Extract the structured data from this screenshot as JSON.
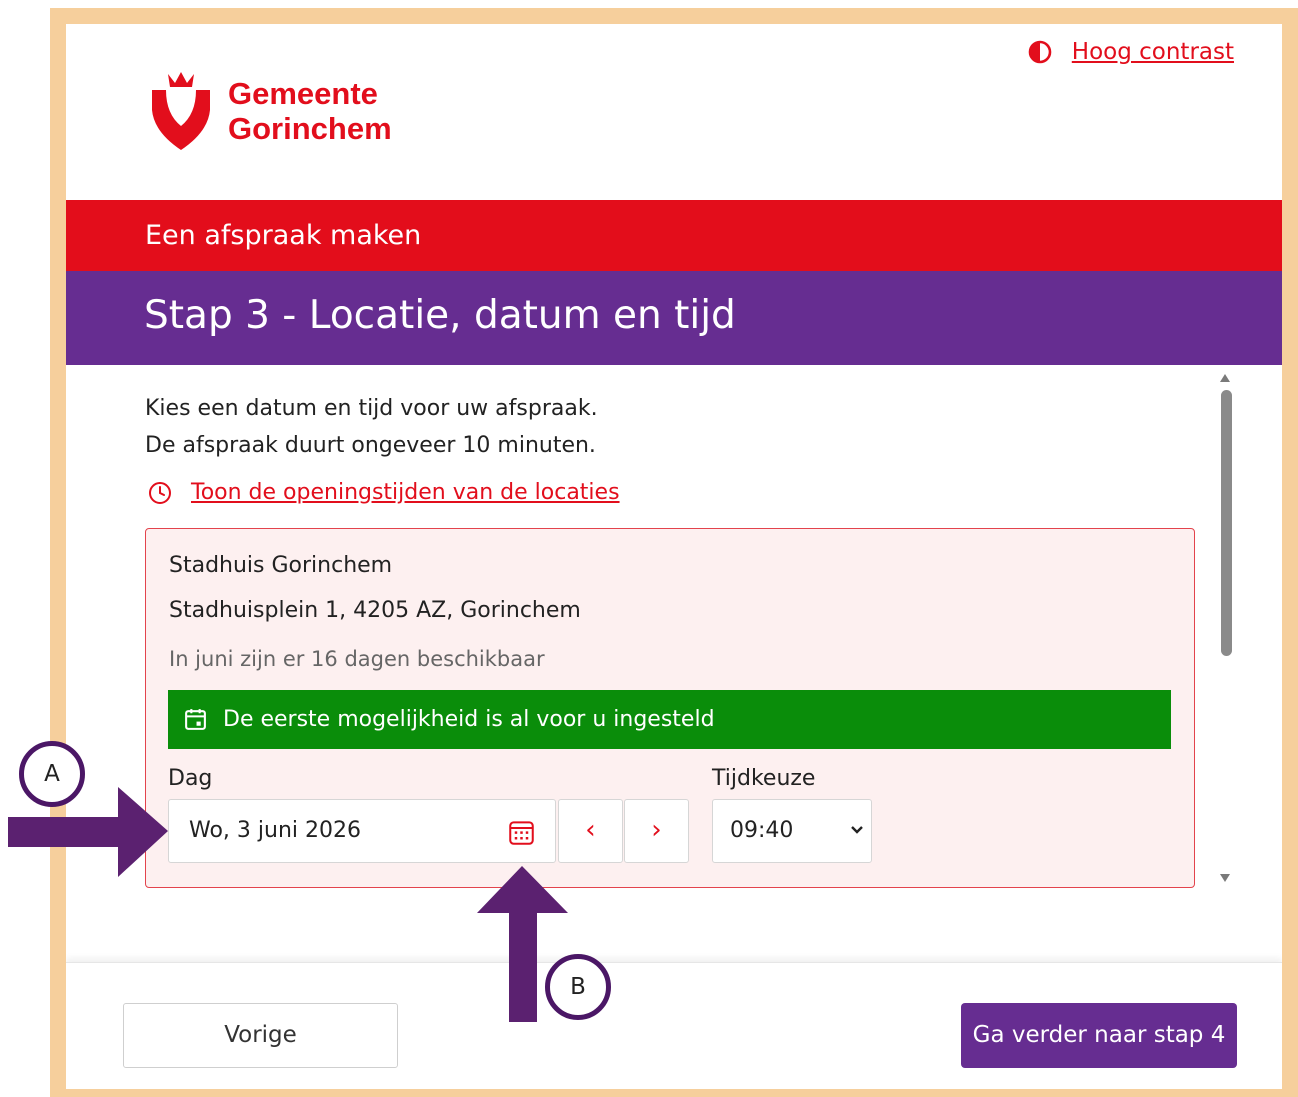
{
  "header": {
    "logo_line1": "Gemeente",
    "logo_line2": "Gorinchem",
    "contrast_label": "Hoog contrast",
    "contrast_icon": "contrast-icon"
  },
  "banner": {
    "title": "Een afspraak maken",
    "step": "Stap 3 - Locatie, datum en tijd"
  },
  "content": {
    "intro_line1": "Kies een datum en tijd voor uw afspraak.",
    "intro_line2": "De afspraak duurt ongeveer 10 minuten.",
    "hours_link": "Toon de openingstijden van de locaties",
    "hours_icon": "clock-icon"
  },
  "location": {
    "name": "Stadhuis Gorinchem",
    "address": "Stadhuisplein 1, 4205 AZ, Gorinchem",
    "availability": "In juni zijn er 16 dagen beschikbaar",
    "notice": "De eerste mogelijkheid is al voor u ingesteld",
    "day_label": "Dag",
    "day_value": "Wo, 3 juni 2026",
    "time_label": "Tijdkeuze",
    "time_value": "09:40",
    "prev_symbol": "‹",
    "next_symbol": "›"
  },
  "footer": {
    "prev_button": "Vorige",
    "next_button": "Ga verder naar stap 4"
  },
  "annotations": {
    "a": "A",
    "b": "B"
  },
  "colors": {
    "brand_red": "#e30d1b",
    "brand_purple": "#662d91",
    "notice_green": "#0a8d0a",
    "frame": "#f6cf9c"
  }
}
